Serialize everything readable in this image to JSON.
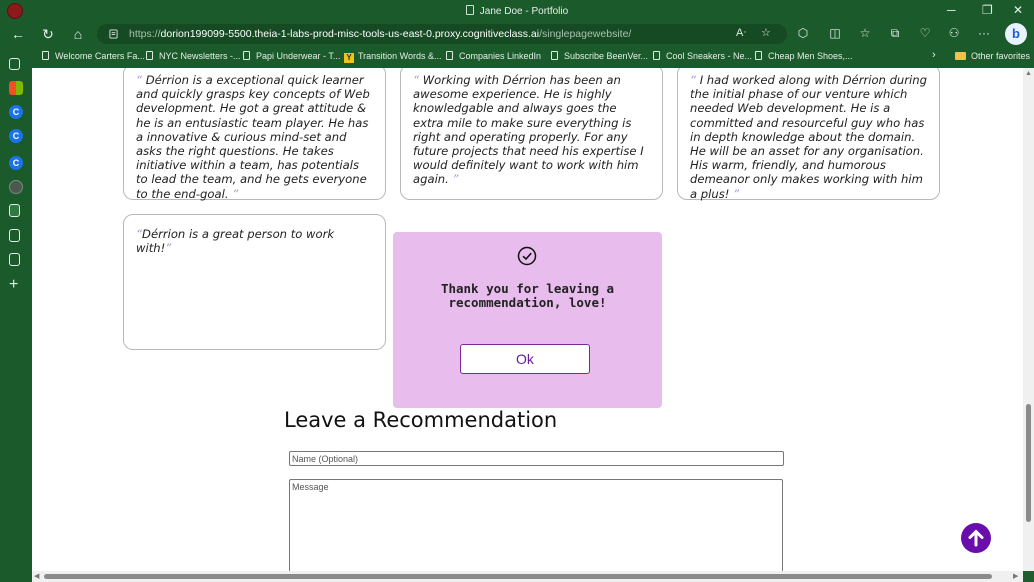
{
  "window": {
    "title": "Jane Doe - Portfolio"
  },
  "address": {
    "url_prefix": "https://",
    "url_host": "dorion199099-5500.theia-1-labs-prod-misc-tools-us-east-0.proxy.cognitiveclass.ai",
    "url_path": "/singlepagewebsite/"
  },
  "bookmarks": [
    {
      "label": "Welcome Carters Fa..."
    },
    {
      "label": "NYC Newsletters -..."
    },
    {
      "label": "Papi Underwear - T..."
    },
    {
      "label": "Transition Words &..."
    },
    {
      "label": "Companies  LinkedIn"
    },
    {
      "label": "Subscribe  BeenVer..."
    },
    {
      "label": "Cool Sneakers - Ne..."
    },
    {
      "label": "Cheap Men Shoes,..."
    }
  ],
  "other_favorites": "Other favorites",
  "recommendations": [
    {
      "text": "Dérrion is a exceptional quick learner and quickly grasps key concepts of Web development. He got a great attitude & he is an entusiastic team player. He has a innovative & curious mind-set and asks the right questions. He takes initiative within a team, has potentials to lead the team, and he gets everyone to the end-goal."
    },
    {
      "text": "Working with Dérrion has been an awesome experience. He is highly knowledgable and always goes the extra mile to make sure everything is right and operating properly. For any future projects that need his expertise I would definitely want to work with him again."
    },
    {
      "text": "I had worked along with Dérrion during the initial phase of our venture which needed Web development. He is a committed and resourceful guy who has in depth knowledge about the domain. He will be an asset for any organisation. His warm, friendly, and humorous demeanor only makes working with him a plus!"
    },
    {
      "text": "Dérrion is a great person to work with!"
    }
  ],
  "quote_open": "“",
  "quote_close": "”",
  "modal": {
    "message": "Thank you for leaving a recommendation, love!",
    "ok_label": "Ok"
  },
  "form": {
    "heading": "Leave a Recommendation",
    "name_placeholder": "Name (Optional)",
    "message_placeholder": "Message"
  },
  "colors": {
    "browser_chrome": "#1b5a2a",
    "modal_bg": "#e8bcec",
    "accent_purple": "#6a0dad"
  }
}
